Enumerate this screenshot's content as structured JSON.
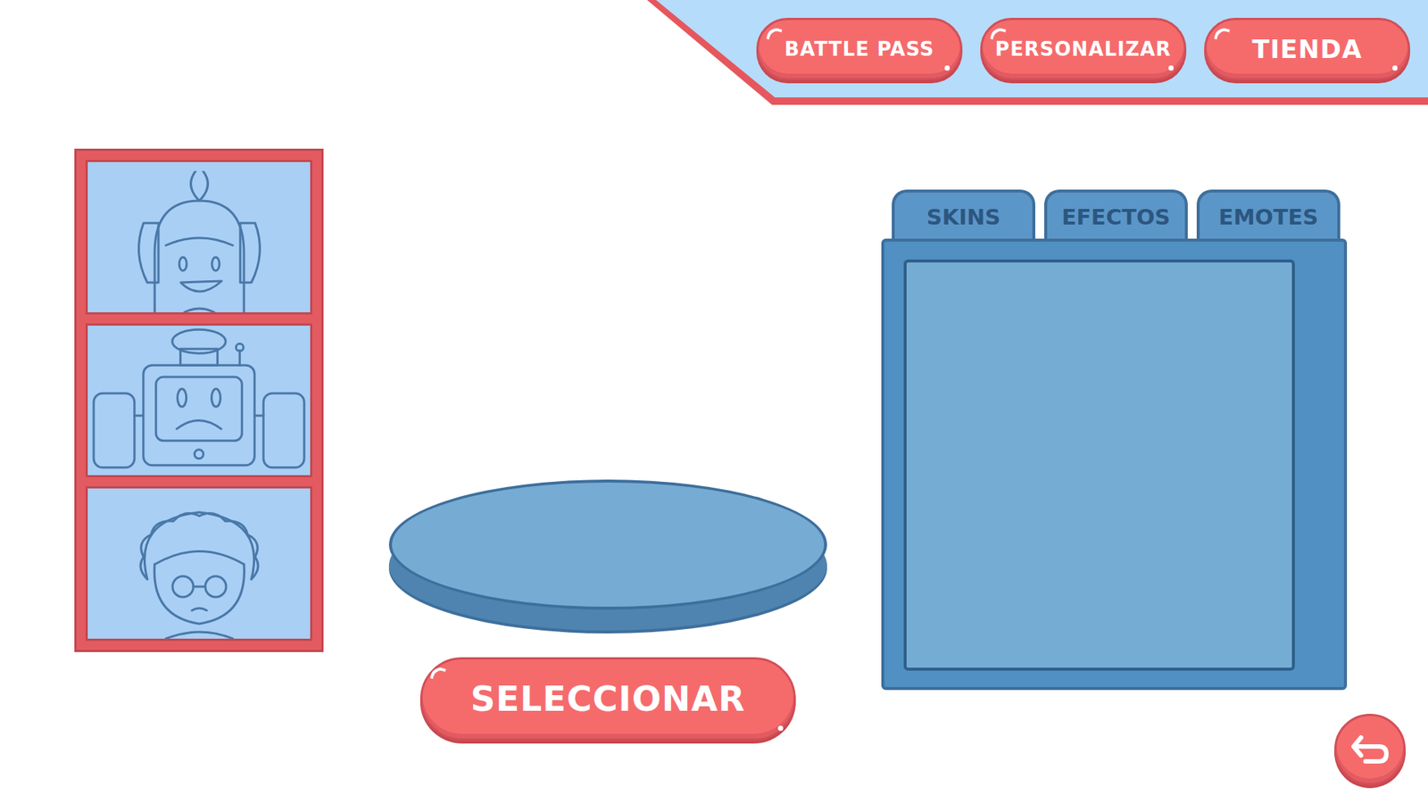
{
  "header": {
    "buttons": [
      "BATTLE PASS",
      "PERSONALIZAR",
      "TIENDA"
    ]
  },
  "characters": [
    {
      "kind": "pilot"
    },
    {
      "kind": "robot"
    },
    {
      "kind": "granny"
    }
  ],
  "select_button": "SELECCIONAR",
  "tabs": [
    {
      "label": "SKINS",
      "selected": false
    },
    {
      "label": "EFECTOS",
      "selected": false
    },
    {
      "label": "EMOTES",
      "selected": false
    }
  ]
}
